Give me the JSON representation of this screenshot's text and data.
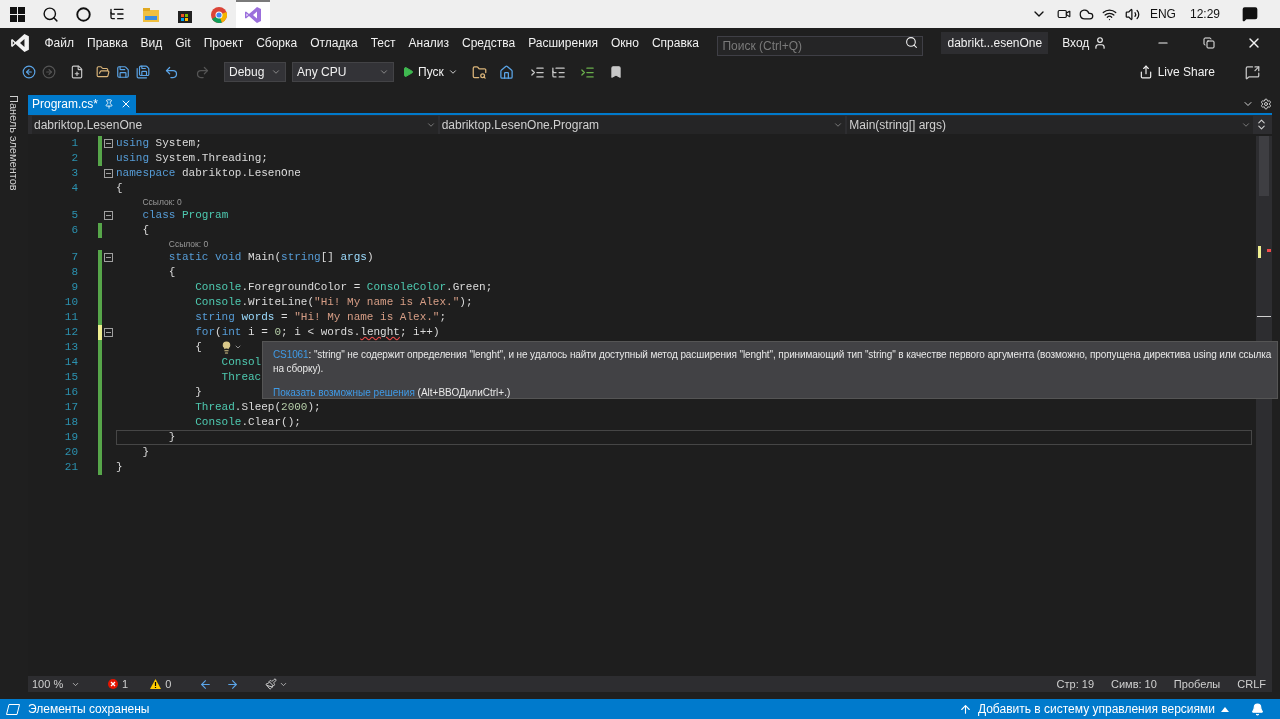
{
  "taskbar": {
    "apps": [
      {
        "kind": "explorer",
        "selected": false
      },
      {
        "kind": "store",
        "selected": false
      },
      {
        "kind": "chrome",
        "selected": false
      },
      {
        "kind": "visual-studio",
        "selected": true
      }
    ],
    "language": "ENG",
    "time": "12:29"
  },
  "menu": {
    "items": [
      "Файл",
      "Правка",
      "Вид",
      "Git",
      "Проект",
      "Сборка",
      "Отладка",
      "Тест",
      "Анализ",
      "Средства",
      "Расширения",
      "Окно",
      "Справка"
    ],
    "search": {
      "placeholder": "Поиск (Ctrl+Q)"
    },
    "solution": "dabrikt...esenOne",
    "sign_in": "Вход"
  },
  "toolbar": {
    "configuration": "Debug",
    "platform": "Any CPU",
    "start": "Пуск",
    "live_share": "Live Share"
  },
  "toolbox_label": "Панель элементов",
  "tabs": [
    {
      "label": "Program.cs*",
      "selected": true
    }
  ],
  "navigation": [
    "dabriktop.LesenOne",
    "dabriktop.LesenOne.Program",
    "Main(string[] args)"
  ],
  "editor": {
    "lines": [
      {
        "number": "1",
        "fold": true,
        "color": "#57a64a",
        "current": false,
        "tokens": [
          {
            "text": "using",
            "kind": "keyword"
          },
          {
            "text": " System;",
            "kind": "plain"
          }
        ]
      },
      {
        "number": "2",
        "fold": false,
        "color": "#57a64a",
        "current": false,
        "tokens": [
          {
            "text": "using",
            "kind": "keyword"
          },
          {
            "text": " System.Threading;",
            "kind": "plain"
          }
        ]
      },
      {
        "number": "3",
        "fold": true,
        "current": false,
        "tokens": [
          {
            "text": "namespace",
            "kind": "keyword"
          },
          {
            "text": " dabriktop.LesenOne",
            "kind": "plain"
          }
        ]
      },
      {
        "number": "4",
        "fold": false,
        "current": false,
        "tokens": [
          {
            "text": "{",
            "kind": "plain"
          }
        ]
      },
      {
        "number": "5",
        "fold": true,
        "current": false,
        "lens": "Ссылок: 0",
        "tokens": [
          {
            "text": "    class",
            "kind": "keyword"
          },
          {
            "text": " Program",
            "kind": "type"
          }
        ]
      },
      {
        "number": "6",
        "fold": false,
        "color": "#57a64a",
        "current": false,
        "tokens": [
          {
            "text": "    {",
            "kind": "plain"
          }
        ]
      },
      {
        "number": "7",
        "fold": true,
        "color": "#57a64a",
        "current": false,
        "lens": "Ссылок: 0",
        "tokens": [
          {
            "text": "        static",
            "kind": "keyword"
          },
          {
            "text": " void",
            "kind": "keyword"
          },
          {
            "text": " Main(",
            "kind": "plain"
          },
          {
            "text": "string",
            "kind": "keyword"
          },
          {
            "text": "[] ",
            "kind": "plain"
          },
          {
            "text": "args",
            "kind": "parameter"
          },
          {
            "text": ")",
            "kind": "plain"
          }
        ]
      },
      {
        "number": "8",
        "fold": false,
        "color": "#57a64a",
        "current": false,
        "tokens": [
          {
            "text": "        {",
            "kind": "plain"
          }
        ]
      },
      {
        "number": "9",
        "fold": false,
        "color": "#57a64a",
        "current": false,
        "tokens": [
          {
            "text": "            Console",
            "kind": "type"
          },
          {
            "text": ".ForegroundColor = ",
            "kind": "plain"
          },
          {
            "text": "ConsoleColor",
            "kind": "type"
          },
          {
            "text": ".Green;",
            "kind": "plain"
          }
        ]
      },
      {
        "number": "10",
        "fold": false,
        "color": "#57a64a",
        "current": false,
        "tokens": [
          {
            "text": "            Console",
            "kind": "type"
          },
          {
            "text": ".WriteLine(",
            "kind": "plain"
          },
          {
            "text": "\"Hi! My name is Alex.\"",
            "kind": "string"
          },
          {
            "text": ");",
            "kind": "plain"
          }
        ]
      },
      {
        "number": "11",
        "fold": false,
        "color": "#57a64a",
        "current": false,
        "tokens": [
          {
            "text": "            string",
            "kind": "keyword"
          },
          {
            "text": " words",
            "kind": "variable"
          },
          {
            "text": " = ",
            "kind": "plain"
          },
          {
            "text": "\"Hi! My name is Alex.\"",
            "kind": "string"
          },
          {
            "text": ";",
            "kind": "plain"
          }
        ]
      },
      {
        "number": "12",
        "fold": true,
        "color": "#efef91",
        "current": false,
        "tokens": [
          {
            "text": "            for",
            "kind": "keyword"
          },
          {
            "text": "(",
            "kind": "plain"
          },
          {
            "text": "int",
            "kind": "keyword"
          },
          {
            "text": " i = ",
            "kind": "plain"
          },
          {
            "text": "0",
            "kind": "number"
          },
          {
            "text": "; i < words.",
            "kind": "plain"
          },
          {
            "text": "lenght",
            "kind": "error"
          },
          {
            "text": "; i++)",
            "kind": "plain"
          }
        ]
      },
      {
        "number": "13",
        "fold": false,
        "color": "#57a64a",
        "current": false,
        "tokens": [
          {
            "text": "            {",
            "kind": "plain"
          }
        ]
      },
      {
        "number": "14",
        "fold": false,
        "color": "#57a64a",
        "current": false,
        "tokens": [
          {
            "text": "                Consol",
            "kind": "type"
          }
        ]
      },
      {
        "number": "15",
        "fold": false,
        "color": "#57a64a",
        "current": false,
        "tokens": [
          {
            "text": "                Threac",
            "kind": "type"
          }
        ]
      },
      {
        "number": "16",
        "fold": false,
        "color": "#57a64a",
        "current": false,
        "tokens": [
          {
            "text": "            }",
            "kind": "plain"
          }
        ]
      },
      {
        "number": "17",
        "fold": false,
        "color": "#57a64a",
        "current": false,
        "tokens": [
          {
            "text": "            Thread",
            "kind": "type"
          },
          {
            "text": ".Sleep(",
            "kind": "plain"
          },
          {
            "text": "2000",
            "kind": "number"
          },
          {
            "text": ");",
            "kind": "plain"
          }
        ]
      },
      {
        "number": "18",
        "fold": false,
        "color": "#57a64a",
        "current": false,
        "tokens": [
          {
            "text": "            Console",
            "kind": "type"
          },
          {
            "text": ".Clear();",
            "kind": "plain"
          }
        ]
      },
      {
        "number": "19",
        "fold": false,
        "color": "#57a64a",
        "current": true,
        "tokens": [
          {
            "text": "        }",
            "kind": "plain"
          }
        ]
      },
      {
        "number": "20",
        "fold": false,
        "color": "#57a64a",
        "current": false,
        "tokens": [
          {
            "text": "    }",
            "kind": "plain"
          }
        ]
      },
      {
        "number": "21",
        "fold": false,
        "color": "#57a64a",
        "current": false,
        "tokens": [
          {
            "text": "}",
            "kind": "plain"
          }
        ]
      }
    ],
    "tooltip": {
      "code": "CS1061",
      "message": ": \"string\" не содержит определения \"lenght\", и не удалось найти доступный метод расширения \"lenght\", принимающий тип \"string\" в качестве первого аргумента (возможно, пропущена директива using или ссылка на сборку).",
      "action": "Показать возможные решения",
      "shortcut": " (Alt+ВВОДилиCtrl+.)"
    }
  },
  "editor_status": {
    "zoom": "100 %",
    "errors": "1",
    "warnings": "0",
    "line": "Стр: 19",
    "column": "Симв: 10",
    "indent": "Пробелы",
    "line_ending": "CRLF"
  },
  "status_bar": {
    "message": "Элементы сохранены",
    "source_control": "Добавить в систему управления версиями"
  }
}
